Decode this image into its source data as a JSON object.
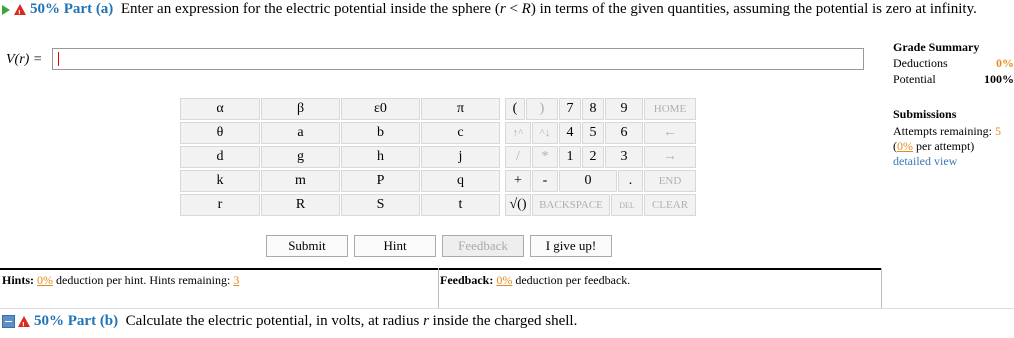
{
  "part_a": {
    "percent": "50%",
    "label": "Part (a)",
    "prompt_before": "Enter an expression for the electric potential inside the sphere (",
    "r": "r",
    "lt": " < ",
    "R": "R",
    "prompt_after": ") in terms of the given quantities, assuming the potential is zero at infinity.",
    "expression_label": "V(r) =",
    "expression_value": ""
  },
  "keypad": {
    "variables": [
      [
        "α",
        "β",
        "ε0",
        "π"
      ],
      [
        "θ",
        "a",
        "b",
        "c"
      ],
      [
        "d",
        "g",
        "h",
        "j"
      ],
      [
        "k",
        "m",
        "P",
        "q"
      ],
      [
        "r",
        "R",
        "S",
        "t"
      ]
    ],
    "top_row": [
      "(",
      ")",
      "7",
      "8",
      "9",
      "HOME"
    ],
    "row2": [
      "↑^",
      "^↓",
      "4",
      "5",
      "6",
      "←"
    ],
    "row3": [
      "/",
      "*",
      "1",
      "2",
      "3",
      "→"
    ],
    "row4": [
      "+",
      "-",
      "0",
      ".",
      "END"
    ],
    "row5": [
      "√()",
      "BACKSPACE",
      "DEL",
      "CLEAR"
    ]
  },
  "buttons": {
    "submit": "Submit",
    "hint": "Hint",
    "feedback": "Feedback",
    "give_up": "I give up!"
  },
  "grade_summary": {
    "title": "Grade Summary",
    "deductions_label": "Deductions",
    "deductions_value": "0%",
    "potential_label": "Potential",
    "potential_value": "100%"
  },
  "submissions": {
    "title": "Submissions",
    "attempts_label": "Attempts remaining:",
    "attempts_value": "5",
    "per_attempt_pct": "0%",
    "per_attempt_text": "per attempt)",
    "detailed_view": "detailed view"
  },
  "hints": {
    "label": "Hints:",
    "pct": "0%",
    "text": "deduction per hint. Hints remaining:",
    "remaining": "3"
  },
  "feedback_info": {
    "label": "Feedback:",
    "pct": "0%",
    "text": "deduction per feedback."
  },
  "part_b": {
    "percent": "50%",
    "label": "Part (b)",
    "prompt_before": "Calculate the electric potential, in volts, at radius",
    "r": "r",
    "prompt_after": "inside the charged shell."
  },
  "colors": {
    "accent": "#1f73b7",
    "orange": "#e88b1c",
    "link": "#3a78b8",
    "warning": "#d82a1f"
  }
}
